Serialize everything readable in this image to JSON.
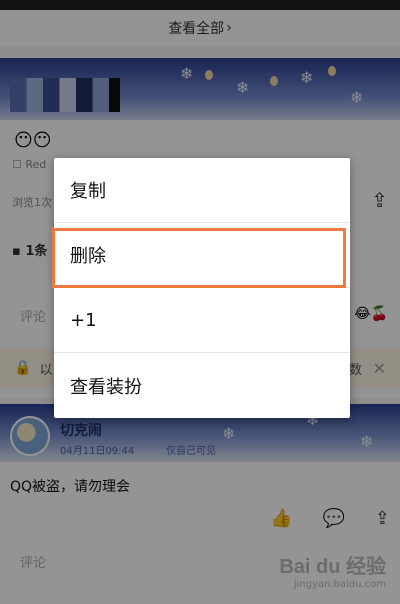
{
  "feed": {
    "view_all_label": "查看全部",
    "emojis": "😶😶",
    "red_meta": "☐ Red",
    "views_label": "浏览1次",
    "comment_count_label": "1条",
    "comment_placeholder": "评论",
    "emoji_right": "😂🍒",
    "notice_text": "以",
    "notice_tail": "数"
  },
  "post": {
    "username": "切克闹",
    "time": "04月11日09:44",
    "privacy": "仅自己可见",
    "text": "QQ被盗，请勿理会",
    "comment_placeholder": "评论"
  },
  "watermark": {
    "brand": "Bai du 经验",
    "url": "jingyan.baidu.com"
  },
  "context_menu": {
    "items": [
      {
        "label": "复制"
      },
      {
        "label": "删除"
      },
      {
        "label": "+1"
      },
      {
        "label": "查看装扮"
      }
    ],
    "highlight_color": "#ef7a3f"
  }
}
